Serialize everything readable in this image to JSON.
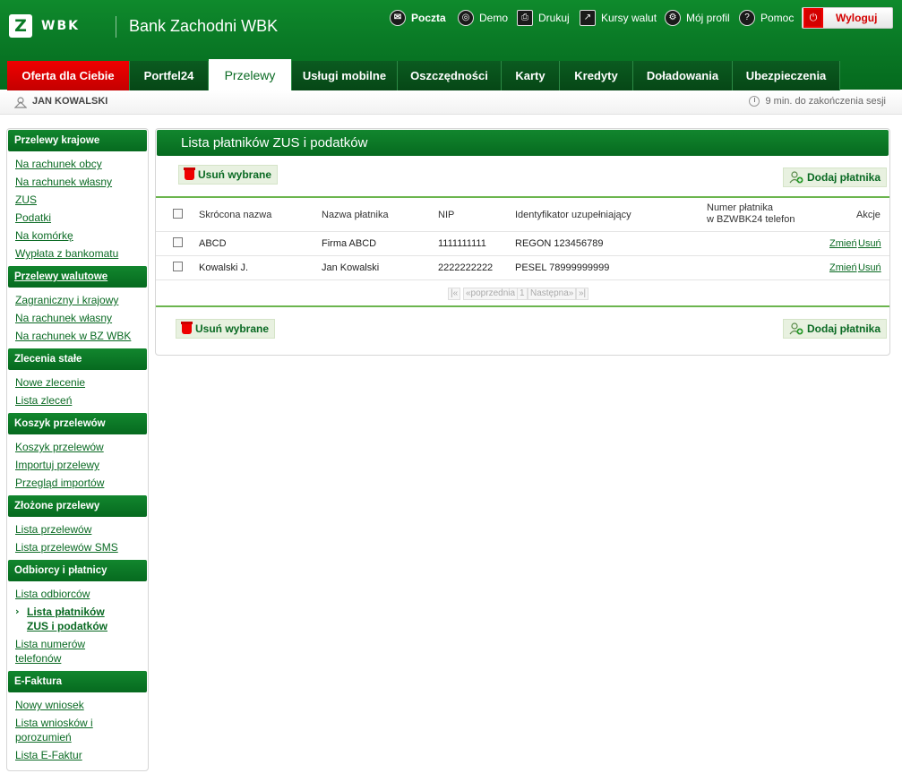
{
  "brand": {
    "logo_mark": "Z",
    "logo_text": "WBK",
    "bank_name": "Bank Zachodni WBK"
  },
  "toplinks": [
    {
      "label": "Poczta",
      "icon": "mail-icon"
    },
    {
      "label": "Demo",
      "icon": "demo-icon"
    },
    {
      "label": "Drukuj",
      "icon": "print-icon"
    },
    {
      "label": "Kursy walut",
      "icon": "chart-icon"
    },
    {
      "label": "Mój profil",
      "icon": "gears-icon"
    },
    {
      "label": "Pomoc",
      "icon": "help-icon"
    }
  ],
  "logout_label": "Wyloguj",
  "tabs": [
    {
      "label": "Oferta dla Ciebie"
    },
    {
      "label": "Portfel24"
    },
    {
      "label": "Przelewy"
    },
    {
      "label": "Usługi mobilne"
    },
    {
      "label": "Oszczędności"
    },
    {
      "label": "Karty"
    },
    {
      "label": "Kredyty"
    },
    {
      "label": "Doładowania"
    },
    {
      "label": "Ubezpieczenia"
    }
  ],
  "user": {
    "name": "JAN KOWALSKI",
    "session": "9 min. do zakończenia sesji"
  },
  "sidebar": {
    "sections": [
      {
        "title": "Przelewy krajowe",
        "items": [
          "Na rachunek obcy",
          "Na rachunek własny",
          "ZUS",
          "Podatki",
          "Na komórkę",
          "Wypłata z bankomatu"
        ]
      },
      {
        "title": "Przelewy walutowe",
        "items": [
          "Zagraniczny i krajowy",
          "Na rachunek własny",
          "Na rachunek w BZ WBK"
        ]
      },
      {
        "title": "Zlecenia stałe",
        "items": [
          "Nowe zlecenie",
          "Lista zleceń"
        ]
      },
      {
        "title": "Koszyk przelewów",
        "items": [
          "Koszyk przelewów",
          "Importuj przelewy",
          "Przegląd importów"
        ]
      },
      {
        "title": "Złożone przelewy",
        "items": [
          "Lista przelewów",
          "Lista przelewów SMS"
        ]
      },
      {
        "title": "Odbiorcy i płatnicy",
        "items": [
          "Lista odbiorców",
          "Lista płatników",
          "ZUS i podatków",
          "Lista numerów",
          "telefonów"
        ]
      },
      {
        "title": "E-Faktura",
        "items": [
          "Nowy wniosek",
          "Lista wniosków i",
          "porozumień",
          "Lista E-Faktur"
        ]
      }
    ]
  },
  "main": {
    "title": "Lista płatników ZUS i podatków",
    "delete_selected": "Usuń wybrane",
    "add_payer": "Dodaj płatnika",
    "columns": {
      "short_name": "Skrócona nazwa",
      "payer_name": "Nazwa płatnika",
      "nip": "NIP",
      "supplementary_id": "Identyfikator uzupełniający",
      "payer_number_line1": "Numer płatnika",
      "payer_number_line2": "w BZWBK24 telefon",
      "actions": "Akcje"
    },
    "rows": [
      {
        "short_name": "ABCD",
        "payer_name": "Firma ABCD",
        "nip": "1111111111",
        "supplementary_id": "REGON 123456789",
        "payer_number": "",
        "edit": "Zmień",
        "delete": "Usuń"
      },
      {
        "short_name": "Kowalski J.",
        "payer_name": "Jan Kowalski",
        "nip": "2222222222",
        "supplementary_id": "PESEL 78999999999",
        "payer_number": "",
        "edit": "Zmień",
        "delete": "Usuń"
      }
    ],
    "pager": {
      "first": "|«",
      "prev": "«poprzednia",
      "page": "1",
      "next": "Następna»",
      "last": "»|"
    }
  }
}
